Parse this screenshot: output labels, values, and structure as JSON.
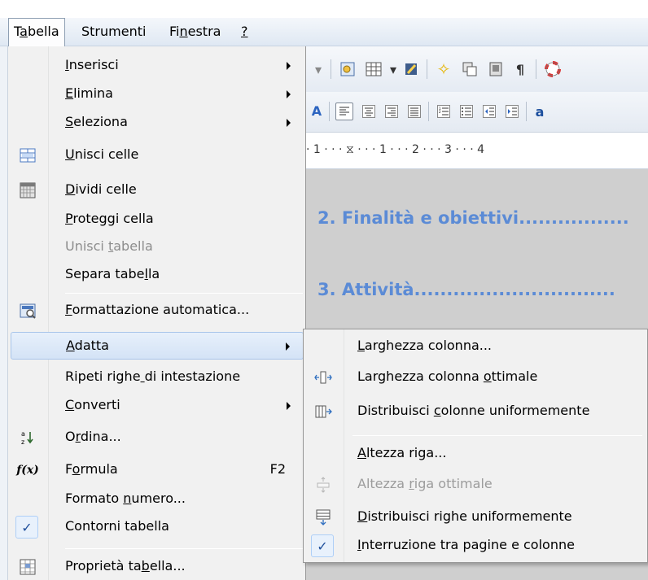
{
  "menubar": {
    "items": [
      {
        "label": "Tabella",
        "mnemonic_index": 1
      },
      {
        "label": "Strumenti",
        "mnemonic_index": -1
      },
      {
        "label": "Finestra",
        "mnemonic_index": 2
      },
      {
        "label": "?",
        "mnemonic_index": 0
      }
    ]
  },
  "tabella_menu": {
    "items": [
      {
        "label": "Inserisci",
        "mnemonic_index": 0,
        "submenu": true
      },
      {
        "label": "Elimina",
        "mnemonic_index": 0,
        "submenu": true
      },
      {
        "label": "Seleziona",
        "mnemonic_index": 0,
        "submenu": true
      },
      {
        "label": "Unisci celle",
        "mnemonic_index": 0,
        "icon": "merge-cells-icon"
      },
      {
        "label": "Dividi celle",
        "mnemonic_index": 0,
        "icon": "split-cells-icon"
      },
      {
        "label": "Proteggi cella",
        "mnemonic_index": 0
      },
      {
        "label": "Unisci tabella",
        "mnemonic_index": 7,
        "disabled": true
      },
      {
        "label": "Separa tabella",
        "mnemonic_index": 11
      },
      {
        "label": "Formattazione automatica...",
        "mnemonic_index": 0,
        "icon": "autoformat-icon"
      },
      {
        "label": "Adatta",
        "mnemonic_index": 0,
        "submenu": true,
        "highlighted": true
      },
      {
        "label": "Ripeti righe di intestazione",
        "mnemonic_index": 12
      },
      {
        "label": "Converti",
        "mnemonic_index": 0,
        "submenu": true
      },
      {
        "label": "Ordina...",
        "mnemonic_index": 1,
        "icon": "sort-icon"
      },
      {
        "label": "Formula",
        "mnemonic_index": 1,
        "shortcut": "F2",
        "icon": "formula-icon"
      },
      {
        "label": "Formato numero...",
        "mnemonic_index": 8
      },
      {
        "label": "Contorni tabella",
        "checked": true,
        "mnemonic_index": -1
      },
      {
        "label": "Proprietà tabella...",
        "mnemonic_index": 12,
        "icon": "table-properties-icon"
      }
    ]
  },
  "adatta_submenu": {
    "items": [
      {
        "label": "Larghezza colonna...",
        "mnemonic_index": 0
      },
      {
        "label": "Larghezza colonna ottimale",
        "mnemonic_index": 18,
        "icon": "optimal-column-width-icon"
      },
      {
        "label": "Distribuisci colonne uniformemente",
        "mnemonic_index": 13,
        "icon": "distribute-columns-icon"
      },
      {
        "label": "Altezza riga...",
        "mnemonic_index": 0
      },
      {
        "label": "Altezza riga ottimale",
        "mnemonic_index": 8,
        "disabled": true,
        "icon": "optimal-row-height-icon"
      },
      {
        "label": "Distribuisci righe uniformemente",
        "mnemonic_index": 0,
        "icon": "distribute-rows-icon"
      },
      {
        "label": "Interruzione tra pagine e colonne",
        "mnemonic_index": 0,
        "checked": true
      }
    ]
  },
  "ruler": {
    "text": "· 1 · · · ⧖ · · · 1 · · · 2 · · · 3 · · · 4"
  },
  "document": {
    "headings": [
      "2. Finalità e obiettivi.................",
      "3. Attività..............................."
    ]
  },
  "icons": {
    "check": "✓",
    "pilcrow": "¶",
    "formula": "f(x)",
    "sort": "a z"
  },
  "colors": {
    "highlight": "#d4e3f6",
    "heading_blue": "#5b8bd6",
    "menu_bg": "#f1f1f1"
  }
}
